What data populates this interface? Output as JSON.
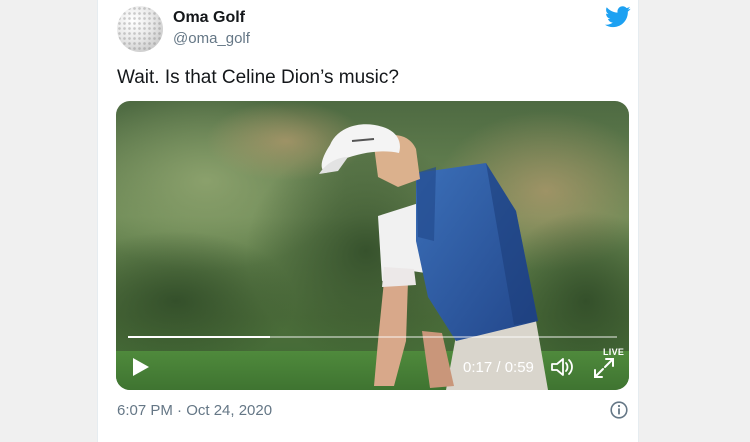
{
  "author": {
    "name": "Oma Golf",
    "handle": "@oma_golf"
  },
  "tweet": {
    "text": "Wait. Is that Celine Dion’s music?"
  },
  "video": {
    "time_display": "0:17 / 0:59",
    "progress_fraction": 0.29,
    "live_label": "LIVE"
  },
  "footer": {
    "timestamp": "6:07 PM · Oct 24, 2020"
  },
  "icons": {
    "brand": "twitter-bird-icon",
    "avatar": "golf-ball",
    "play": "play-icon",
    "volume": "volume-icon",
    "fullscreen": "fullscreen-icon",
    "info": "info-icon"
  },
  "colors": {
    "twitter_blue": "#1da1f2",
    "text_primary": "#14171a",
    "text_secondary": "#657786",
    "vest_blue": "#2f5fa3"
  }
}
